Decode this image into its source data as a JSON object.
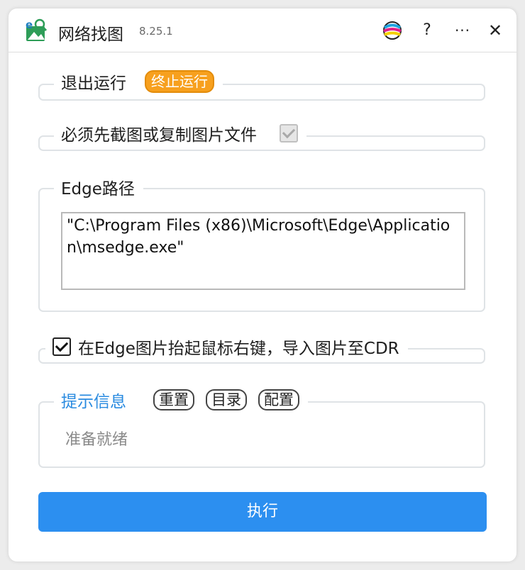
{
  "header": {
    "title": "网络找图",
    "version": "8.25.1",
    "help_label": "?",
    "more_label": "···",
    "close_label": "✕"
  },
  "run_group": {
    "label": "退出运行",
    "stop_button": "终止运行"
  },
  "require_group": {
    "label": "必须先截图或复制图片文件",
    "checked": true
  },
  "edge_group": {
    "label": "Edge路径",
    "path_value": "\"C:\\Program Files (x86)\\Microsoft\\Edge\\Application\\msedge.exe\""
  },
  "import_group": {
    "label": "在Edge图片抬起鼠标右键，导入图片至CDR",
    "checked": true
  },
  "tips_group": {
    "label": "提示信息",
    "reset_button": "重置",
    "directory_button": "目录",
    "config_button": "配置",
    "status": "准备就绪"
  },
  "execute_button": "执行",
  "colors": {
    "accent": "#2c8ff0",
    "stop_button": "#f7a01e",
    "tips_title": "#2a8be0"
  }
}
